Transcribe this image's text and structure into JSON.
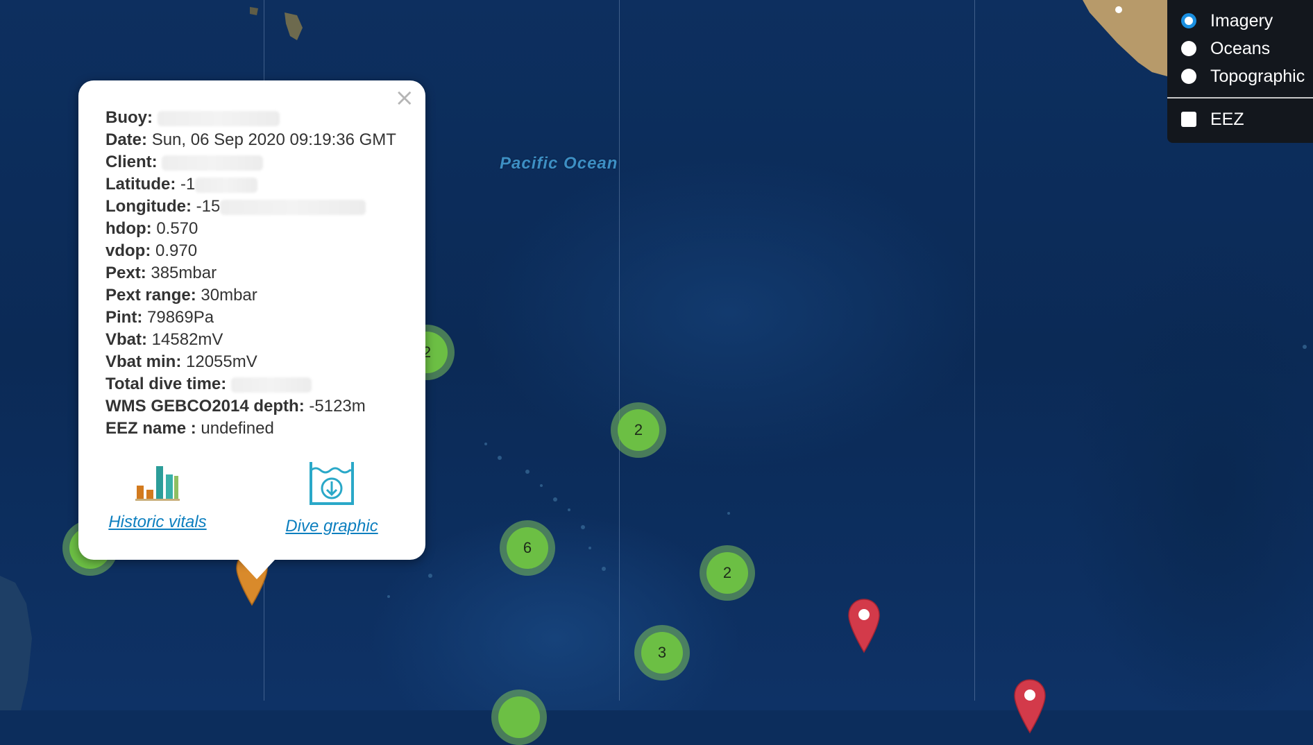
{
  "map": {
    "ocean_label": "Pacific Ocean",
    "clusters": [
      {
        "count": "2"
      },
      {
        "count": "2"
      },
      {
        "count": "6"
      },
      {
        "count": "2"
      },
      {
        "count": "3"
      }
    ],
    "marker_colors": {
      "selected": "#d98a2b",
      "other": "#d33a4a"
    },
    "cluster_color": "#6cbf44"
  },
  "popup": {
    "close_icon": "×",
    "fields": [
      {
        "label": "Buoy:",
        "value": ""
      },
      {
        "label": "Date:",
        "value": "Sun, 06 Sep 2020 09:19:36 GMT"
      },
      {
        "label": "Client:",
        "value": ""
      },
      {
        "label": "Latitude:",
        "value": "-1"
      },
      {
        "label": "Longitude:",
        "value": "-15"
      },
      {
        "label": "hdop:",
        "value": "0.570"
      },
      {
        "label": "vdop:",
        "value": "0.970"
      },
      {
        "label": "Pext:",
        "value": "385mbar"
      },
      {
        "label": "Pext range:",
        "value": "30mbar"
      },
      {
        "label": "Pint:",
        "value": "79869Pa"
      },
      {
        "label": "Vbat:",
        "value": "14582mV"
      },
      {
        "label": "Vbat min:",
        "value": "12055mV"
      },
      {
        "label": "Total dive time:",
        "value": ""
      },
      {
        "label": "WMS GEBCO2014 depth:",
        "value": "-5123m"
      },
      {
        "label": "EEZ name :",
        "value": "undefined"
      }
    ],
    "actions": {
      "historic_vitals": {
        "label": "Historic vitals",
        "icon": "bar-chart-icon"
      },
      "dive_graphic": {
        "label": "Dive graphic",
        "icon": "dive-icon"
      }
    }
  },
  "layers": {
    "base_layers": [
      {
        "label": "Imagery",
        "selected": true
      },
      {
        "label": "Oceans",
        "selected": false
      },
      {
        "label": "Topographic",
        "selected": false
      }
    ],
    "overlays": [
      {
        "label": "EEZ",
        "checked": false
      }
    ]
  }
}
